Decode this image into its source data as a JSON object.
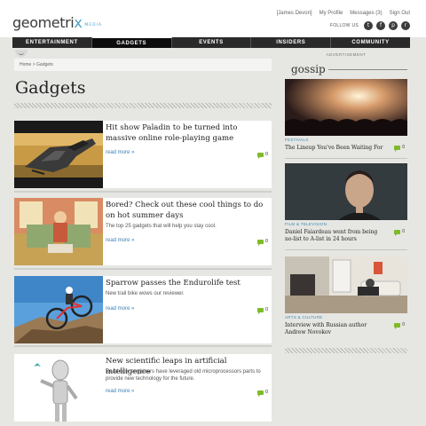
{
  "brand": {
    "logo_main": "geometri",
    "logo_x": "x",
    "logo_sub": "MEDIA"
  },
  "user_links": [
    "[James Devon]",
    "My Profile",
    "Messages (3)",
    "Sign Out"
  ],
  "follow": {
    "label": "FOLLOW US",
    "icons": [
      "twitter-icon",
      "facebook-icon",
      "pinterest-icon",
      "rss-icon"
    ],
    "glyphs": [
      "t",
      "f",
      "p",
      "r"
    ]
  },
  "nav": {
    "items": [
      "ENTERTAINMENT",
      "GADGETS",
      "EVENTS",
      "INSIDERS",
      "COMMUNITY"
    ],
    "active": "GADGETS"
  },
  "breadcrumb": "Home > Gadgets",
  "page": {
    "title": "Gadgets"
  },
  "articles": [
    {
      "title": "Hit show Paladin to be turned into massive online role-playing game",
      "description": "",
      "read_more": "read more »",
      "comments": "0"
    },
    {
      "title": "Bored? Check out these cool things to do on hot summer days",
      "description": "The top 25 gadgets that will help you stay cool.",
      "read_more": "read more »",
      "comments": "0"
    },
    {
      "title": "Sparrow passes the Endurolife test",
      "description": "New trail bike wows our reviewer.",
      "read_more": "read more »",
      "comments": "0"
    },
    {
      "title": "New scientific leaps in artificial intelligence",
      "description": "Read how engineers have leveraged old microprocessors parts to provide new technology for the future.",
      "read_more": "read more »",
      "comments": "0"
    }
  ],
  "sidebar": {
    "advert_label": "ADVERTISEMENT",
    "title": "gossip",
    "cards": [
      {
        "category": "FESTIVALS",
        "title": "The Lineup You've Been Waiting For",
        "comments": "0"
      },
      {
        "category": "FILM & TELEVISION",
        "title": "Daniel Faiardeau went from being no-list to A-list in 24 hours",
        "comments": "0"
      },
      {
        "category": "ARTS & CULTURE",
        "title": "Interview with Russian author Andrew Novokov",
        "comments": "0"
      }
    ]
  },
  "colors": {
    "accent": "#3a7fb8",
    "comment_green": "#7dbb28",
    "nav_bg": "#2a2a2a"
  }
}
